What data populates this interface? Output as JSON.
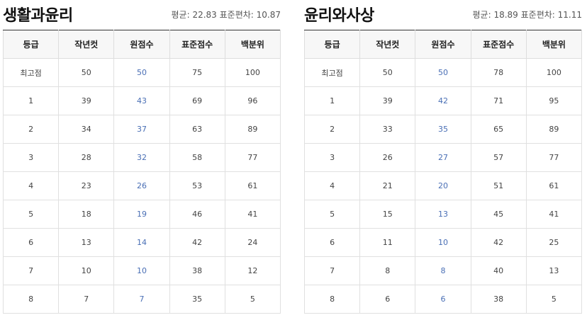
{
  "tables": [
    {
      "title": "생활과윤리",
      "stats": "평균: 22.83 표준편차: 10.87",
      "headers": [
        "등급",
        "작년컷",
        "원점수",
        "표준점수",
        "백분위"
      ],
      "rows": [
        [
          "최고점",
          "50",
          "50",
          "75",
          "100"
        ],
        [
          "1",
          "39",
          "43",
          "69",
          "96"
        ],
        [
          "2",
          "34",
          "37",
          "63",
          "89"
        ],
        [
          "3",
          "28",
          "32",
          "58",
          "77"
        ],
        [
          "4",
          "23",
          "26",
          "53",
          "61"
        ],
        [
          "5",
          "18",
          "19",
          "46",
          "41"
        ],
        [
          "6",
          "13",
          "14",
          "42",
          "24"
        ],
        [
          "7",
          "10",
          "10",
          "38",
          "12"
        ],
        [
          "8",
          "7",
          "7",
          "35",
          "5"
        ]
      ]
    },
    {
      "title": "윤리와사상",
      "stats": "평균: 18.89 표준편차: 11.11",
      "headers": [
        "등급",
        "작년컷",
        "원점수",
        "표준점수",
        "백분위"
      ],
      "rows": [
        [
          "최고점",
          "50",
          "50",
          "78",
          "100"
        ],
        [
          "1",
          "39",
          "42",
          "71",
          "95"
        ],
        [
          "2",
          "33",
          "35",
          "65",
          "89"
        ],
        [
          "3",
          "26",
          "27",
          "57",
          "77"
        ],
        [
          "4",
          "21",
          "20",
          "51",
          "61"
        ],
        [
          "5",
          "15",
          "13",
          "45",
          "41"
        ],
        [
          "6",
          "11",
          "10",
          "42",
          "25"
        ],
        [
          "7",
          "8",
          "8",
          "40",
          "13"
        ],
        [
          "8",
          "6",
          "6",
          "38",
          "5"
        ]
      ]
    }
  ],
  "colors": {
    "raw_score": "#4a6fb5",
    "header_bg": "#f7f7f7",
    "header_top_border": "#333333"
  }
}
